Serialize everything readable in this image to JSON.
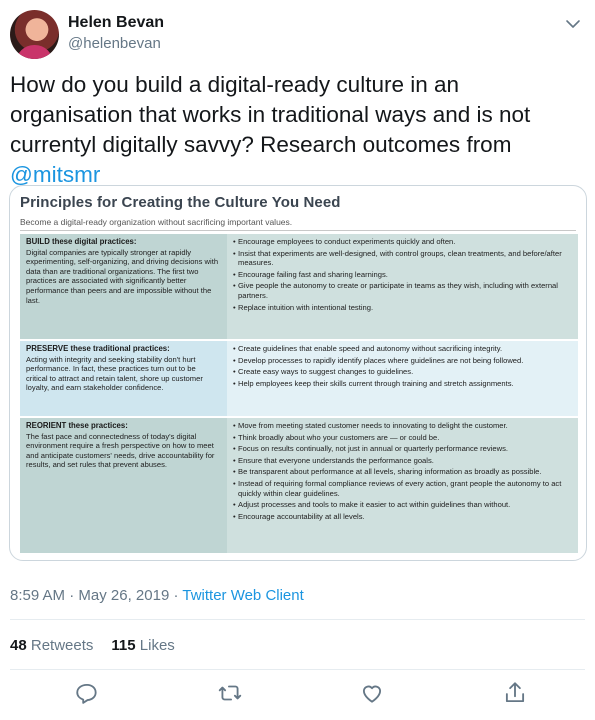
{
  "user": {
    "name": "Helen Bevan",
    "handle": "@helenbevan"
  },
  "tweet": {
    "text_before": "How do you build a digital-ready culture in an organisation that works in traditional ways and is not currentyl digitally savvy? Research outcomes from ",
    "mention": "@mitsmr"
  },
  "card": {
    "title": "Principles for Creating the Culture You Need",
    "subtitle": "Become a digital-ready organization without sacrificing important values.",
    "sections": [
      {
        "title": "BUILD these digital practices:",
        "text": "Digital companies are typically stronger at rapidly experimenting, self-organizing, and driving decisions with data than are traditional organizations. The first two practices are associated with significantly better performance than peers and are impossible without the last.",
        "bullets": [
          "Encourage employees to conduct experiments quickly and often.",
          "Insist that experiments are well-designed, with control groups, clean treatments, and before/after measures.",
          "Encourage failing fast and sharing learnings.",
          "Give people the autonomy to create or participate in teams as they wish, including with external partners.",
          "Replace intuition with intentional testing."
        ]
      },
      {
        "title": "PRESERVE these traditional practices:",
        "text": "Acting with integrity and seeking stability don't hurt performance. In fact, these practices turn out to be critical to attract and retain talent, shore up customer loyalty, and earn stakeholder confidence.",
        "bullets": [
          "Create guidelines that enable speed and autonomy without sacrificing integrity.",
          "Develop processes to rapidly identify places where guidelines are not being followed.",
          "Create easy ways to suggest changes to guidelines.",
          "Help employees keep their skills current through training and stretch assignments."
        ]
      },
      {
        "title": "REORIENT these practices:",
        "text": "The fast pace and connectedness of today's digital environment require a fresh perspective on how to meet and anticipate customers' needs, drive accountability for results, and set rules that prevent abuses.",
        "bullets": [
          "Move from meeting stated customer needs to innovating to delight the customer.",
          "Think broadly about who your customers are — or could be.",
          "Focus on results continually, not just in annual or quarterly performance reviews.",
          "Ensure that everyone understands the performance goals.",
          "Be transparent about performance at all levels, sharing information as broadly as possible.",
          "Instead of requiring formal compliance reviews of every action, grant people the autonomy to act quickly within clear guidelines.",
          "Adjust processes and tools to make it easier to act within guidelines than without.",
          "Encourage accountability at all levels."
        ]
      }
    ]
  },
  "meta": {
    "time": "8:59 AM",
    "separator": " · ",
    "date": "May 26, 2019",
    "client": "Twitter Web Client"
  },
  "stats": {
    "retweets_count": "48",
    "retweets_label": "Retweets",
    "likes_count": "115",
    "likes_label": "Likes"
  },
  "icons": {
    "caret": "chevron-down-icon",
    "reply": "reply-icon",
    "retweet": "retweet-icon",
    "like": "heart-icon",
    "share": "share-icon"
  },
  "colors": {
    "link": "#1b95e0",
    "secondary_text": "#657786",
    "build_bg": "#bfd5d3",
    "preserve_bg": "#cfe6ef"
  }
}
